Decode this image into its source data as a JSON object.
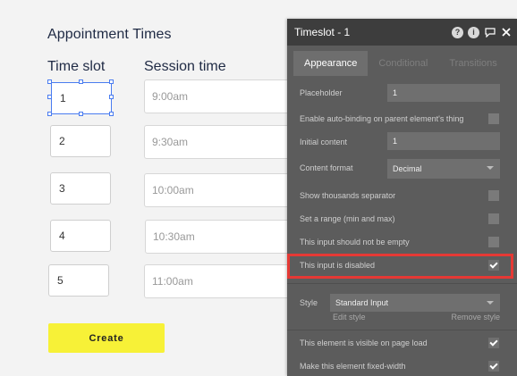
{
  "canvas": {
    "heading": "Appointment Times",
    "time_slot_label": "Time slot",
    "session_time_label": "Session time",
    "slots": [
      "1",
      "2",
      "3",
      "4",
      "5"
    ],
    "sessions": [
      "9:00am",
      "9:30am",
      "10:00am",
      "10:30am",
      "11:00am"
    ],
    "create_button": "Create"
  },
  "panel": {
    "title": "Timeslot - 1",
    "icons": [
      "help-icon",
      "info-icon",
      "comment-icon",
      "close-icon"
    ],
    "tabs": [
      "Appearance",
      "Conditional",
      "Transitions"
    ],
    "active_tab": "Appearance",
    "placeholder_label": "Placeholder",
    "placeholder_value": "1",
    "autobinding_label": "Enable auto-binding on parent element's thing",
    "initial_content_label": "Initial content",
    "initial_content_value": "1",
    "content_format_label": "Content format",
    "content_format_value": "Decimal",
    "thousands_label": "Show thousands separator",
    "range_label": "Set a range (min and max)",
    "not_empty_label": "This input should not be empty",
    "disabled_label": "This input is disabled",
    "disabled_checked": true,
    "style_label": "Style",
    "style_value": "Standard Input",
    "edit_style": "Edit style",
    "remove_style": "Remove style",
    "visible_label": "This element is visible on page load",
    "visible_checked": true,
    "fixed_width_label": "Make this element fixed-width",
    "fixed_width_checked": true
  },
  "colors": {
    "selection": "#4a7cf0",
    "create_button_bg": "#f7f137",
    "highlight": "#e53935",
    "panel_bg": "#5c5c5c",
    "panel_header_bg": "#3d3d3d"
  }
}
